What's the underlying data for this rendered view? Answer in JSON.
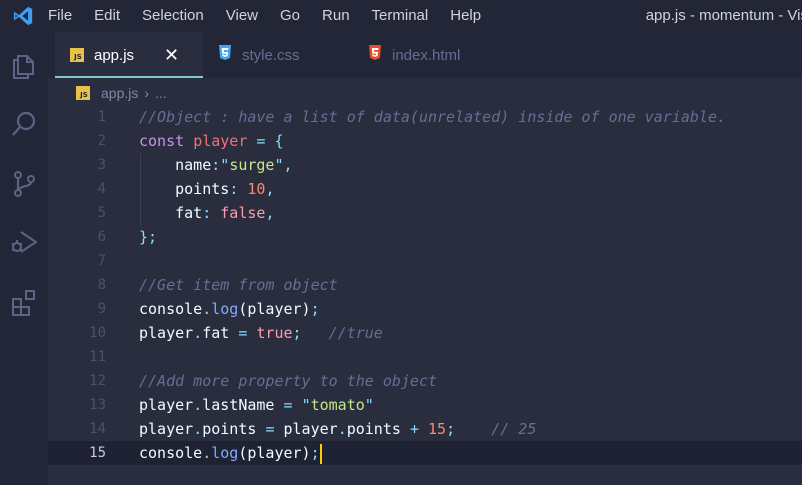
{
  "app": {
    "window_title": "app.js - momentum - Vis",
    "menu": [
      "File",
      "Edit",
      "Selection",
      "View",
      "Go",
      "Run",
      "Terminal",
      "Help"
    ]
  },
  "activity_bar": {
    "icons": [
      "explorer-icon",
      "search-icon",
      "source-control-icon",
      "run-debug-icon",
      "extensions-icon"
    ]
  },
  "tabs": [
    {
      "label": "app.js",
      "icon": "js-file-icon",
      "icon_text": "JS",
      "active": true
    },
    {
      "label": "style.css",
      "icon": "css-file-icon",
      "active": false
    },
    {
      "label": "index.html",
      "icon": "html-file-icon",
      "active": false
    }
  ],
  "breadcrumb": {
    "file": "app.js",
    "rest": "..."
  },
  "editor": {
    "current_line": 15,
    "lines": [
      {
        "n": "1",
        "tokens": [
          [
            "c-comment",
            "//Object : have a list of data(unrelated) inside of one variable."
          ]
        ]
      },
      {
        "n": "2",
        "tokens": [
          [
            "c-kw",
            "const"
          ],
          [
            "c-plain",
            " "
          ],
          [
            "c-var",
            "player"
          ],
          [
            "c-plain",
            " "
          ],
          [
            "c-op",
            "="
          ],
          [
            "c-plain",
            " "
          ],
          [
            "c-punc",
            "{"
          ]
        ]
      },
      {
        "n": "3",
        "tokens": [
          [
            "c-plain",
            "    "
          ],
          [
            "c-prop",
            "name"
          ],
          [
            "c-punc",
            ":"
          ],
          [
            "c-punc",
            "\""
          ],
          [
            "c-str",
            "surge"
          ],
          [
            "c-punc",
            "\""
          ],
          [
            "c-punc",
            ","
          ]
        ]
      },
      {
        "n": "4",
        "tokens": [
          [
            "c-plain",
            "    "
          ],
          [
            "c-prop",
            "points"
          ],
          [
            "c-punc",
            ":"
          ],
          [
            "c-plain",
            " "
          ],
          [
            "c-num",
            "10"
          ],
          [
            "c-punc",
            ","
          ]
        ]
      },
      {
        "n": "5",
        "tokens": [
          [
            "c-plain",
            "    "
          ],
          [
            "c-prop",
            "fat"
          ],
          [
            "c-punc",
            ":"
          ],
          [
            "c-plain",
            " "
          ],
          [
            "c-bool",
            "false"
          ],
          [
            "c-punc",
            ","
          ]
        ]
      },
      {
        "n": "6",
        "tokens": [
          [
            "c-punc",
            "}"
          ],
          [
            "c-punc",
            ";"
          ]
        ]
      },
      {
        "n": "7",
        "tokens": []
      },
      {
        "n": "8",
        "tokens": [
          [
            "c-comment",
            "//Get item from object"
          ]
        ]
      },
      {
        "n": "9",
        "tokens": [
          [
            "c-plain",
            "console"
          ],
          [
            "c-punc",
            "."
          ],
          [
            "c-fn",
            "log"
          ],
          [
            "c-plain",
            "(player)"
          ],
          [
            "c-punc",
            ";"
          ]
        ]
      },
      {
        "n": "10",
        "tokens": [
          [
            "c-plain",
            "player"
          ],
          [
            "c-punc",
            "."
          ],
          [
            "c-plain",
            "fat "
          ],
          [
            "c-op",
            "="
          ],
          [
            "c-plain",
            " "
          ],
          [
            "c-bool",
            "true"
          ],
          [
            "c-punc",
            ";"
          ],
          [
            "c-plain",
            "   "
          ],
          [
            "c-comment",
            "//true"
          ]
        ]
      },
      {
        "n": "11",
        "tokens": []
      },
      {
        "n": "12",
        "tokens": [
          [
            "c-comment",
            "//Add more property to the object"
          ]
        ]
      },
      {
        "n": "13",
        "tokens": [
          [
            "c-plain",
            "player"
          ],
          [
            "c-punc",
            "."
          ],
          [
            "c-plain",
            "lastName "
          ],
          [
            "c-op",
            "="
          ],
          [
            "c-plain",
            " "
          ],
          [
            "c-punc",
            "\""
          ],
          [
            "c-str",
            "tomato"
          ],
          [
            "c-punc",
            "\""
          ]
        ]
      },
      {
        "n": "14",
        "tokens": [
          [
            "c-plain",
            "player"
          ],
          [
            "c-punc",
            "."
          ],
          [
            "c-plain",
            "points "
          ],
          [
            "c-op",
            "="
          ],
          [
            "c-plain",
            " player"
          ],
          [
            "c-punc",
            "."
          ],
          [
            "c-plain",
            "points "
          ],
          [
            "c-op",
            "+"
          ],
          [
            "c-plain",
            " "
          ],
          [
            "c-num",
            "15"
          ],
          [
            "c-punc",
            ";"
          ],
          [
            "c-plain",
            "    "
          ],
          [
            "c-comment",
            "// 25"
          ]
        ]
      },
      {
        "n": "15",
        "tokens": [
          [
            "c-plain",
            "console"
          ],
          [
            "c-punc",
            "."
          ],
          [
            "c-fn",
            "log"
          ],
          [
            "c-plain",
            "(player)"
          ],
          [
            "c-punc",
            ";"
          ]
        ]
      }
    ]
  },
  "colors": {
    "background": "#292d3e",
    "chrome": "#232636",
    "cursor": "#ffcc00",
    "js_badge": "#e8c14b",
    "css_icon": "#42a5f5",
    "html_icon": "#e44d26"
  }
}
